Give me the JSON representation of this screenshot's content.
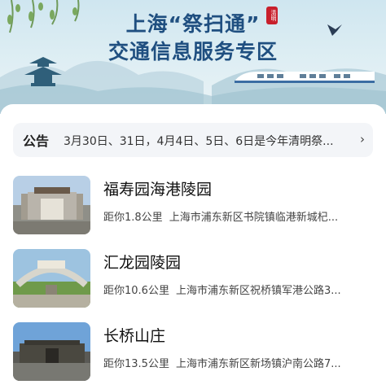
{
  "banner": {
    "title_line1": "上海“祭扫通”",
    "seal_text": "清明",
    "title_line2": "交通信息服务专区"
  },
  "notice": {
    "badge": "公告",
    "text": "3月30日、31日，4月4日、5日、6日是今年清明祭...",
    "chevron_icon": "chevron-right-icon"
  },
  "cemeteries": [
    {
      "name": "福寿园海港陵园",
      "distance": "距你1.8公里",
      "address": "上海市浦东新区书院镇临港新城杞..."
    },
    {
      "name": "汇龙园陵园",
      "distance": "距你10.6公里",
      "address": "上海市浦东新区祝桥镇军港公路3..."
    },
    {
      "name": "长桥山庄",
      "distance": "距你13.5公里",
      "address": "上海市浦东新区新场镇沪南公路7..."
    }
  ]
}
